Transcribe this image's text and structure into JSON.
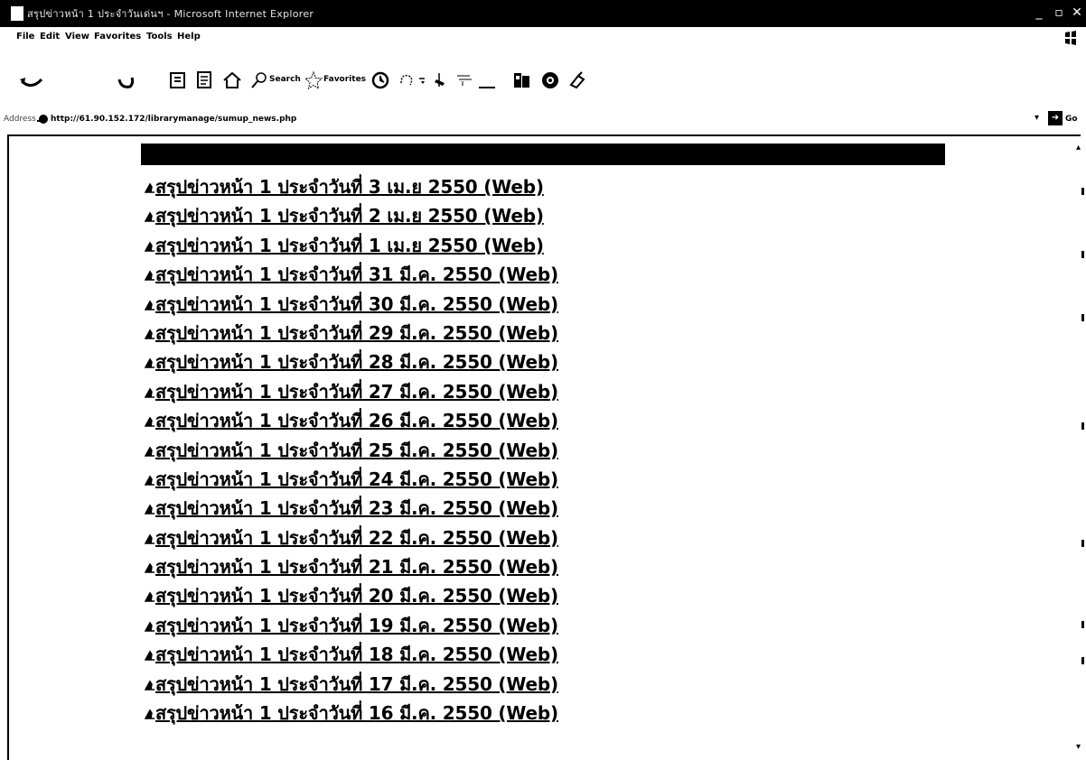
{
  "window": {
    "title": "สรุปข่าวหน้า 1 ประจำวันเด่นฯ - Microsoft Internet Explorer",
    "controls": {
      "minimize": "_",
      "maximize": "▫",
      "close": "✕"
    }
  },
  "menu": [
    "File",
    "Edit",
    "View",
    "Favorites",
    "Tools",
    "Help"
  ],
  "toolbar": {
    "search_label": "Search",
    "favorites_label": "Favorites"
  },
  "address": {
    "label": "Address",
    "url": "http://61.90.152.172/librarymanage/sumup_news.php",
    "go_label": "Go"
  },
  "news": [
    "สรุปข่าวหน้า 1 ประจำวันที่ 3 เม.ย 2550 (Web)",
    "สรุปข่าวหน้า 1 ประจำวันที่ 2 เม.ย 2550 (Web)",
    "สรุปข่าวหน้า 1 ประจำวันที่ 1 เม.ย 2550 (Web)",
    "สรุปข่าวหน้า 1 ประจำวันที่ 31 มี.ค. 2550 (Web)",
    "สรุปข่าวหน้า 1 ประจำวันที่ 30 มี.ค. 2550 (Web)",
    "สรุปข่าวหน้า 1 ประจำวันที่ 29 มี.ค. 2550 (Web)",
    "สรุปข่าวหน้า 1 ประจำวันที่ 28 มี.ค. 2550 (Web)",
    "สรุปข่าวหน้า 1 ประจำวันที่ 27 มี.ค. 2550 (Web)",
    "สรุปข่าวหน้า 1 ประจำวันที่ 26 มี.ค. 2550 (Web)",
    "สรุปข่าวหน้า 1 ประจำวันที่ 25 มี.ค. 2550 (Web)",
    "สรุปข่าวหน้า 1 ประจำวันที่ 24 มี.ค. 2550 (Web)",
    "สรุปข่าวหน้า 1 ประจำวันที่ 23 มี.ค. 2550 (Web)",
    "สรุปข่าวหน้า 1 ประจำวันที่ 22 มี.ค. 2550 (Web)",
    "สรุปข่าวหน้า 1 ประจำวันที่ 21 มี.ค. 2550 (Web)",
    "สรุปข่าวหน้า 1 ประจำวันที่ 20 มี.ค. 2550 (Web)",
    "สรุปข่าวหน้า 1 ประจำวันที่ 19 มี.ค. 2550 (Web)",
    "สรุปข่าวหน้า 1 ประจำวันที่ 18 มี.ค. 2550 (Web)",
    "สรุปข่าวหน้า 1 ประจำวันที่ 17 มี.ค. 2550 (Web)",
    "สรุปข่าวหน้า 1 ประจำวันที่ 16 มี.ค. 2550 (Web)"
  ],
  "icons": {
    "bullet": "triangle-bullet-icon"
  }
}
